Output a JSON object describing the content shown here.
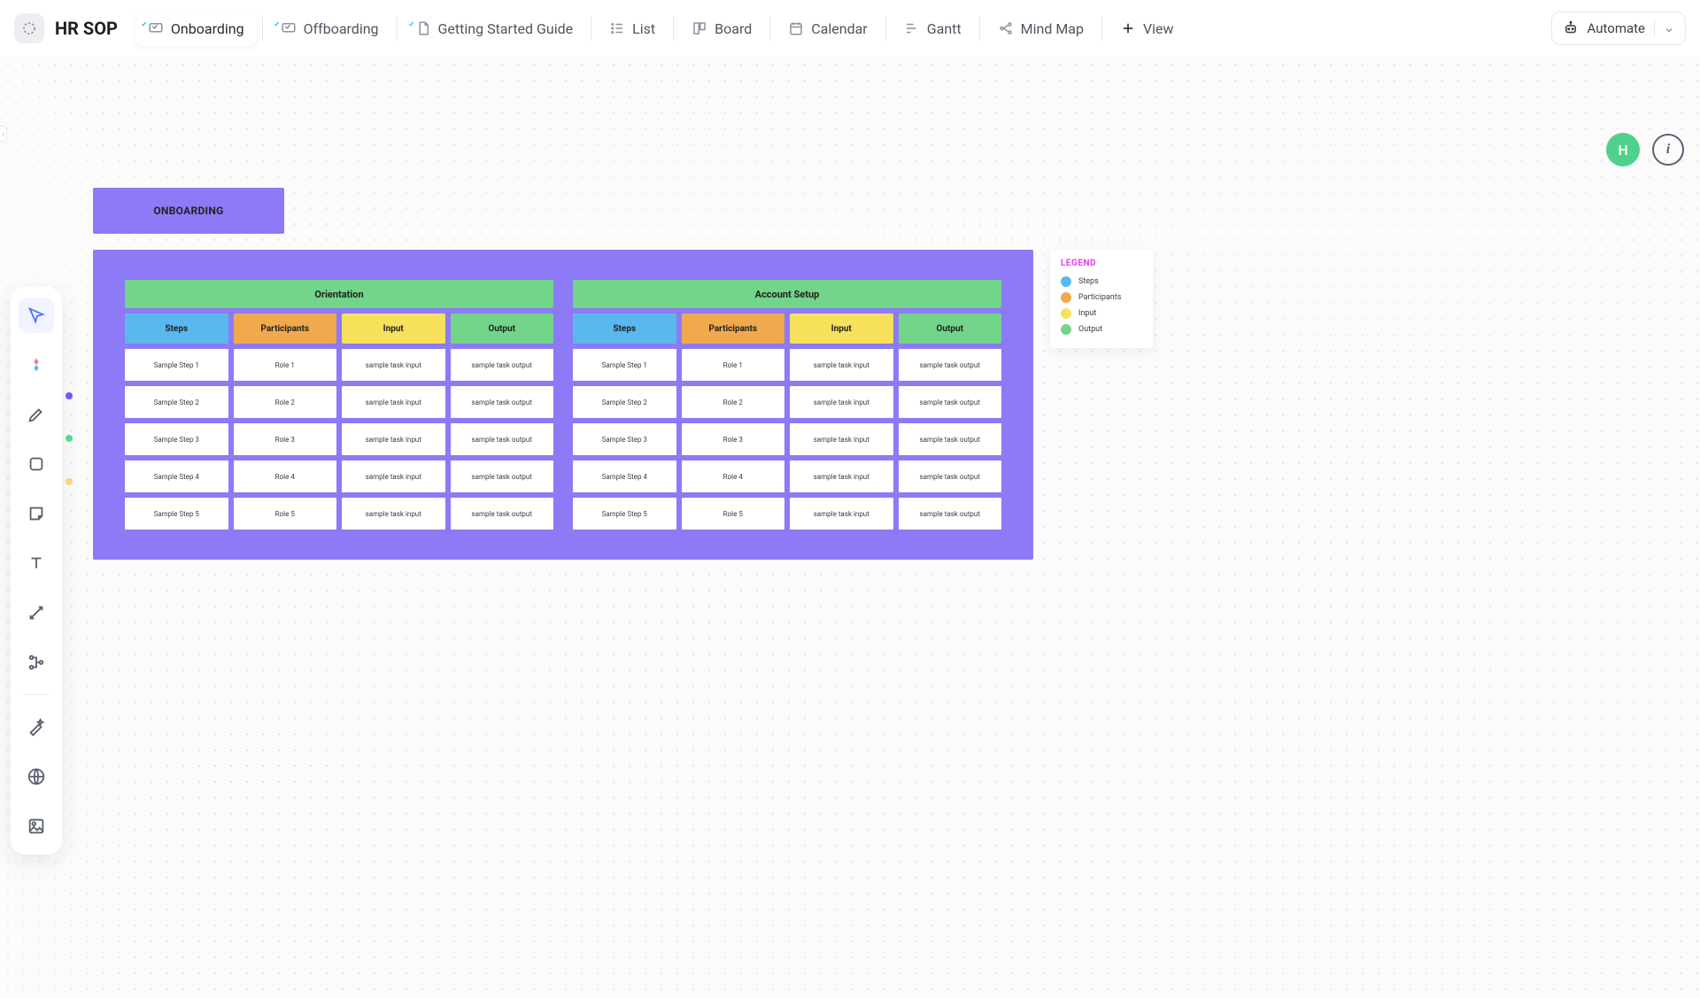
{
  "header": {
    "app_title": "HR SOP",
    "tabs": [
      {
        "label": "Onboarding",
        "active": true,
        "pinned": true
      },
      {
        "label": "Offboarding",
        "pinned": true
      },
      {
        "label": "Getting Started Guide",
        "pinned": true
      },
      {
        "label": "List"
      },
      {
        "label": "Board"
      },
      {
        "label": "Calendar"
      },
      {
        "label": "Gantt"
      },
      {
        "label": "Mind Map"
      }
    ],
    "add_view_label": "View",
    "automate_label": "Automate"
  },
  "overlay": {
    "avatar_initial": "H"
  },
  "board": {
    "title": "ONBOARDING",
    "sections": [
      {
        "title": "Orientation",
        "columns": [
          "Steps",
          "Participants",
          "Input",
          "Output"
        ],
        "rows": [
          [
            "Sample Step 1",
            "Role 1",
            "sample task input",
            "sample task output"
          ],
          [
            "Sample Step 2",
            "Role 2",
            "sample task input",
            "sample task output"
          ],
          [
            "Sample Step 3",
            "Role 3",
            "sample task input",
            "sample task output"
          ],
          [
            "Sample Step 4",
            "Role 4",
            "sample task input",
            "sample task output"
          ],
          [
            "Sample Step 5",
            "Role 5",
            "sample task input",
            "sample task output"
          ]
        ]
      },
      {
        "title": "Account Setup",
        "columns": [
          "Steps",
          "Participants",
          "Input",
          "Output"
        ],
        "rows": [
          [
            "Sample Step 1",
            "Role 1",
            "sample task input",
            "sample task output"
          ],
          [
            "Sample Step 2",
            "Role 2",
            "sample task input",
            "sample task output"
          ],
          [
            "Sample Step 3",
            "Role 3",
            "sample task input",
            "sample task output"
          ],
          [
            "Sample Step 4",
            "Role 4",
            "sample task input",
            "sample task output"
          ],
          [
            "Sample Step 5",
            "Role 5",
            "sample task input",
            "sample task output"
          ]
        ]
      }
    ]
  },
  "legend": {
    "title": "LEGEND",
    "items": [
      {
        "label": "Steps",
        "color": "#5bb8ef"
      },
      {
        "label": "Participants",
        "color": "#f1a94e"
      },
      {
        "label": "Input",
        "color": "#f7e05b"
      },
      {
        "label": "Output",
        "color": "#72d58a"
      }
    ]
  },
  "colors": {
    "purple": "#8c7af7",
    "green": "#72d58a",
    "blue": "#5bb8ef",
    "orange": "#f1a94e",
    "yellow": "#f7e05b"
  }
}
